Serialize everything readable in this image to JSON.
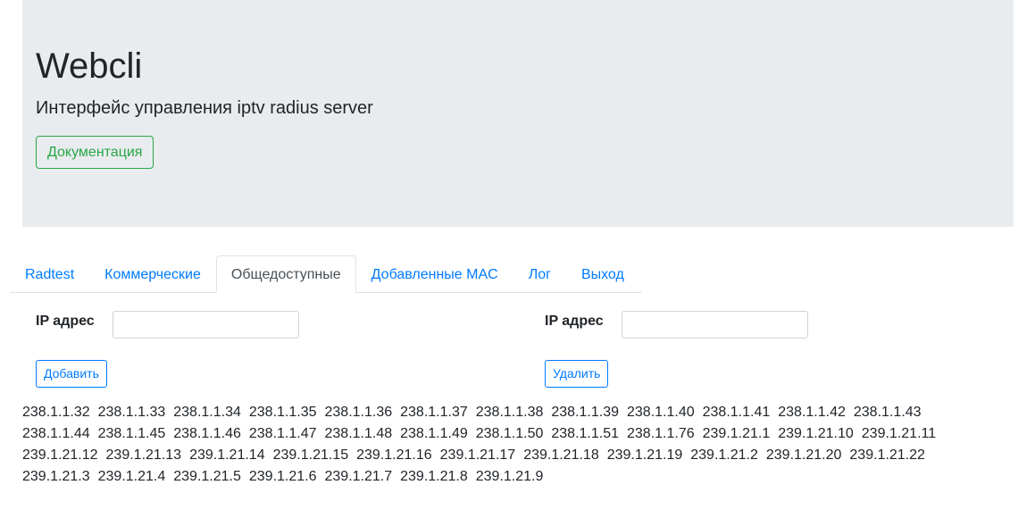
{
  "header": {
    "title": "Webcli",
    "subtitle": "Интерфейс управления iptv radius server",
    "doc_button": "Документация"
  },
  "tabs": [
    {
      "label": "Radtest",
      "active": false
    },
    {
      "label": "Коммерческие",
      "active": false
    },
    {
      "label": "Общедоступные",
      "active": true
    },
    {
      "label": "Добавленные MAC",
      "active": false
    },
    {
      "label": "Лог",
      "active": false
    },
    {
      "label": "Выход",
      "active": false
    }
  ],
  "add_form": {
    "label": "IP адрес",
    "value": "",
    "button": "Добавить"
  },
  "delete_form": {
    "label": "IP адрес",
    "value": "",
    "button": "Удалить"
  },
  "ip_list": [
    "238.1.1.32",
    "238.1.1.33",
    "238.1.1.34",
    "238.1.1.35",
    "238.1.1.36",
    "238.1.1.37",
    "238.1.1.38",
    "238.1.1.39",
    "238.1.1.40",
    "238.1.1.41",
    "238.1.1.42",
    "238.1.1.43",
    "238.1.1.44",
    "238.1.1.45",
    "238.1.1.46",
    "238.1.1.47",
    "238.1.1.48",
    "238.1.1.49",
    "238.1.1.50",
    "238.1.1.51",
    "238.1.1.76",
    "239.1.21.1",
    "239.1.21.10",
    "239.1.21.11",
    "239.1.21.12",
    "239.1.21.13",
    "239.1.21.14",
    "239.1.21.15",
    "239.1.21.16",
    "239.1.21.17",
    "239.1.21.18",
    "239.1.21.19",
    "239.1.21.2",
    "239.1.21.20",
    "239.1.21.22",
    "239.1.21.3",
    "239.1.21.4",
    "239.1.21.5",
    "239.1.21.6",
    "239.1.21.7",
    "239.1.21.8",
    "239.1.21.9"
  ],
  "colors": {
    "primary": "#007bff",
    "success": "#28a745",
    "jumbotron_bg": "#e9ecef",
    "text": "#212529"
  }
}
